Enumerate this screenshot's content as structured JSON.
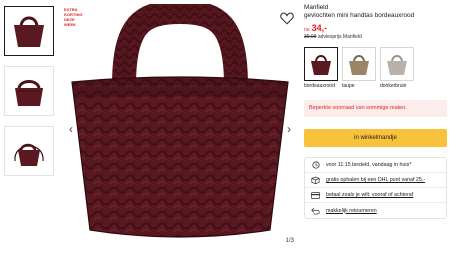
{
  "promo_badge": "EXTRA KORTING DEZE WEEK",
  "brand": "Manfield",
  "product_title": "gevlochten mini handtas bordeauxrood",
  "price": {
    "prefix": "nu",
    "current": "34,-",
    "advice_old": "39,99",
    "advice_label": "adviesprijs Manfield"
  },
  "image_counter": "1/3",
  "variants": [
    {
      "label": "bordeauxrood",
      "color": "#5a1820",
      "selected": true
    },
    {
      "label": "taupe",
      "color": "#9c8468",
      "selected": false
    },
    {
      "label": "donkerbruin",
      "color": "#b9b2ac",
      "selected": false
    }
  ],
  "stock_notice": "Beperkte voorraad van sommige maten.",
  "cart_button": "in winkelmandje",
  "usps": [
    {
      "icon": "clock-icon",
      "text": "voor 11:15 besteld, vandaag in huis*"
    },
    {
      "icon": "package-icon",
      "text": "gratis ophalen bij een DHL punt vanaf 25,-"
    },
    {
      "icon": "card-icon",
      "text": "betaal zoals je wilt: vooraf of achteraf"
    },
    {
      "icon": "return-icon",
      "text": "makkelijk retourneren"
    }
  ],
  "colors": {
    "accent_red": "#e2231a",
    "cart_yellow": "#f9c23c",
    "notice_bg": "#fdecec",
    "bag_main": "#5a1820"
  }
}
